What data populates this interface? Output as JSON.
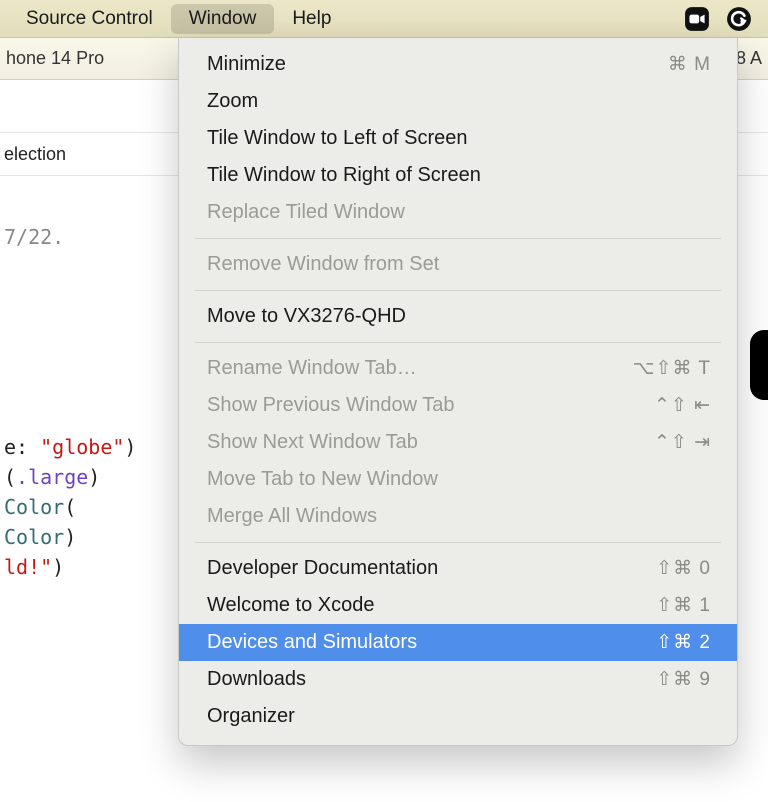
{
  "menubar": {
    "items": [
      {
        "label": "Source Control",
        "active": false
      },
      {
        "label": "Window",
        "active": true
      },
      {
        "label": "Help",
        "active": false
      }
    ]
  },
  "toolbar": {
    "device": "hone 14 Pro",
    "right": "8 A"
  },
  "selection_label": "election",
  "code": {
    "comment_date": "7/22.",
    "line1_prefix": "e: ",
    "line1_str": "\"globe\"",
    "line1_suffix": ")",
    "line2_prefix": "(",
    "line2_arg": ".large",
    "line2_suffix": ")",
    "line3_call": "Color",
    "line3_suffix": "(",
    "line4_call": "Color",
    "line4_suffix": ")",
    "line5_str": "ld!\"",
    "line5_suffix": ")"
  },
  "dropdown": {
    "groups": [
      [
        {
          "label": "Minimize",
          "shortcut": "⌘ M",
          "disabled": false
        },
        {
          "label": "Zoom",
          "shortcut": "",
          "disabled": false
        },
        {
          "label": "Tile Window to Left of Screen",
          "shortcut": "",
          "disabled": false
        },
        {
          "label": "Tile Window to Right of Screen",
          "shortcut": "",
          "disabled": false
        },
        {
          "label": "Replace Tiled Window",
          "shortcut": "",
          "disabled": true
        }
      ],
      [
        {
          "label": "Remove Window from Set",
          "shortcut": "",
          "disabled": true
        }
      ],
      [
        {
          "label": "Move to VX3276-QHD",
          "shortcut": "",
          "disabled": false
        }
      ],
      [
        {
          "label": "Rename Window Tab…",
          "shortcut": "⌥⇧⌘ T",
          "disabled": true
        },
        {
          "label": "Show Previous Window Tab",
          "shortcut": "⌃⇧ ⇤",
          "disabled": true
        },
        {
          "label": "Show Next Window Tab",
          "shortcut": "⌃⇧ ⇥",
          "disabled": true
        },
        {
          "label": "Move Tab to New Window",
          "shortcut": "",
          "disabled": true
        },
        {
          "label": "Merge All Windows",
          "shortcut": "",
          "disabled": true
        }
      ],
      [
        {
          "label": "Developer Documentation",
          "shortcut": "⇧⌘ 0",
          "disabled": false
        },
        {
          "label": "Welcome to Xcode",
          "shortcut": "⇧⌘ 1",
          "disabled": false
        },
        {
          "label": "Devices and Simulators",
          "shortcut": "⇧⌘ 2",
          "disabled": false,
          "highlight": true
        },
        {
          "label": "Downloads",
          "shortcut": "⇧⌘ 9",
          "disabled": false
        },
        {
          "label": "Organizer",
          "shortcut": "",
          "disabled": false
        }
      ]
    ]
  }
}
